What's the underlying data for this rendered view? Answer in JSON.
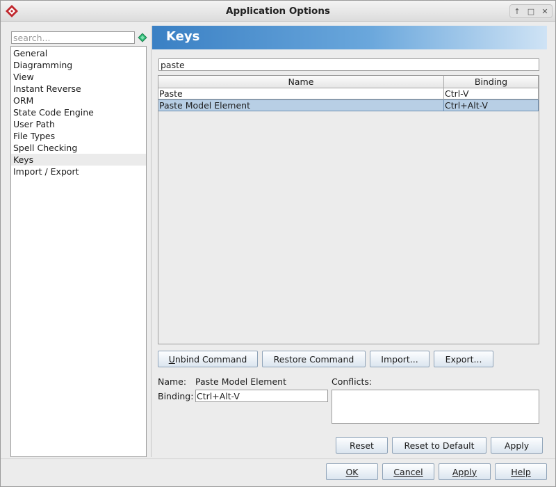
{
  "window": {
    "title": "Application Options"
  },
  "sidebar": {
    "search_placeholder": "search...",
    "items": [
      {
        "label": "General"
      },
      {
        "label": "Diagramming"
      },
      {
        "label": "View"
      },
      {
        "label": "Instant Reverse"
      },
      {
        "label": "ORM"
      },
      {
        "label": "State Code Engine"
      },
      {
        "label": "User Path"
      },
      {
        "label": "File Types"
      },
      {
        "label": "Spell Checking"
      },
      {
        "label": "Keys"
      },
      {
        "label": "Import / Export"
      }
    ],
    "selected": "Keys"
  },
  "page": {
    "title": "Keys",
    "filter_value": "paste",
    "table": {
      "columns": [
        "Name",
        "Binding"
      ],
      "rows": [
        {
          "name": "Paste",
          "binding": "Ctrl-V",
          "selected": false
        },
        {
          "name": "Paste Model Element",
          "binding": "Ctrl+Alt-V",
          "selected": true
        }
      ]
    },
    "buttons": {
      "unbind_prefix": "U",
      "unbind_rest": "nbind Command",
      "restore": "Restore Command",
      "import": "Import...",
      "export": "Export..."
    },
    "detail": {
      "name_label": "Name:",
      "name_value": "Paste Model Element",
      "binding_label": "Binding:",
      "binding_value": "Ctrl+Alt-V",
      "conflicts_label": "Conflicts:"
    },
    "actions": {
      "reset": "Reset",
      "reset_default": "Reset to Default",
      "apply": "Apply"
    }
  },
  "footer": {
    "ok": "OK",
    "cancel": "Cancel",
    "apply": "Apply",
    "help": "Help"
  },
  "colors": {
    "header_gradient_start": "#3a80c4",
    "header_gradient_end": "#cfe3f5",
    "selection": "#b8cfe5",
    "app_icon_red": "#c0272d"
  }
}
